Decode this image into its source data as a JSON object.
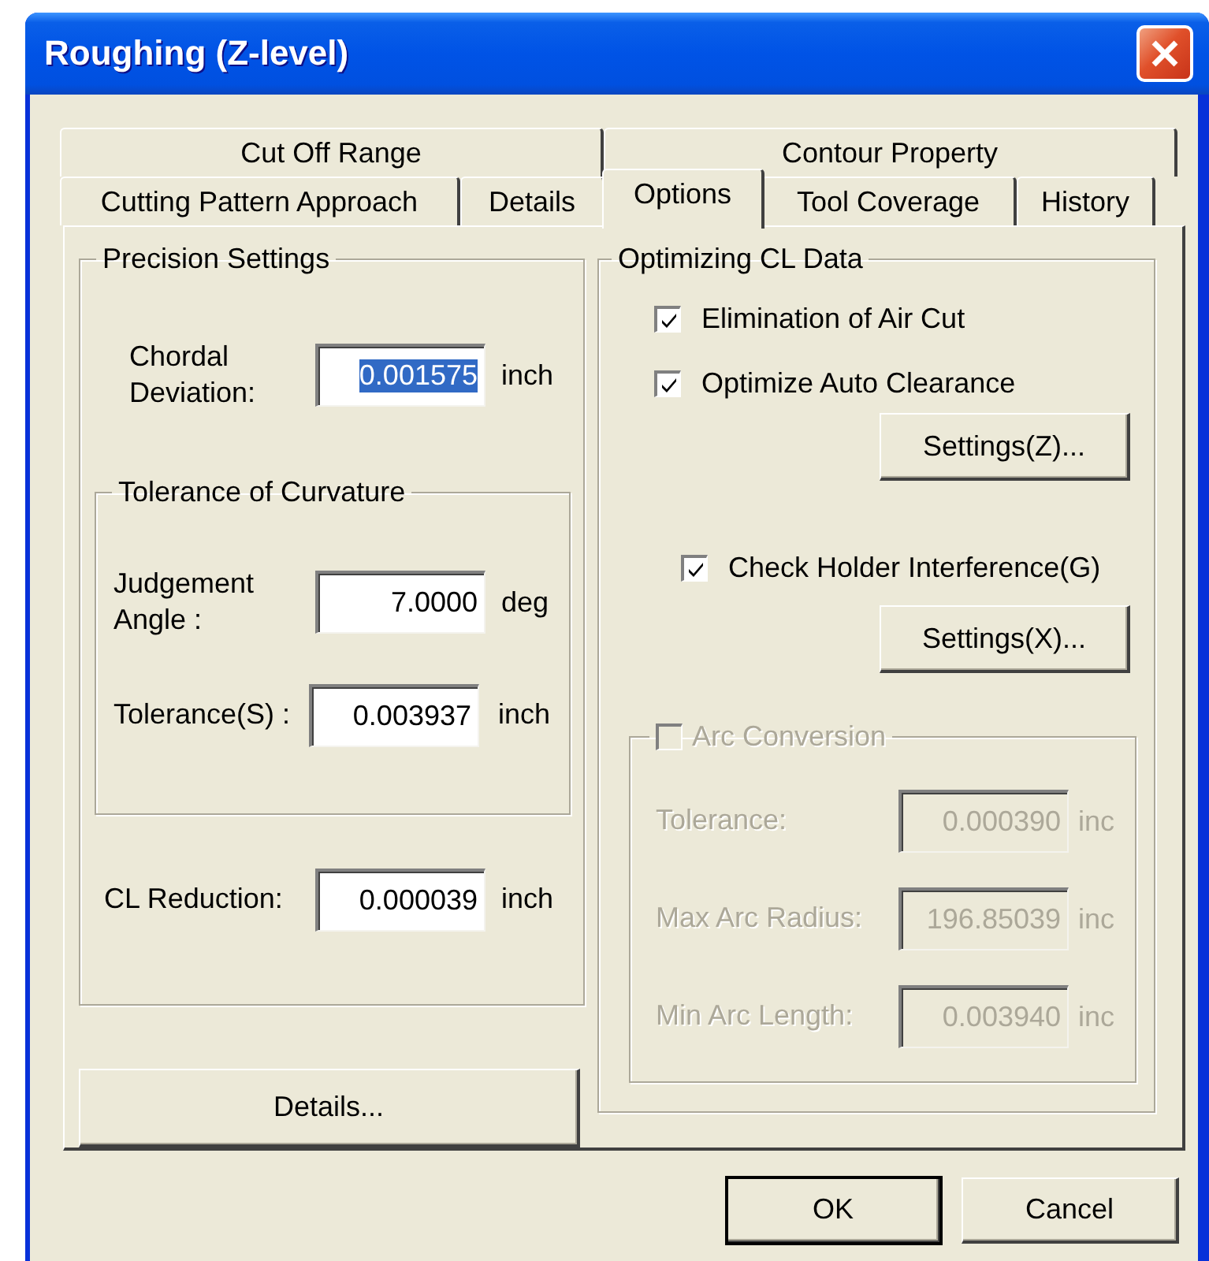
{
  "window": {
    "title": "Roughing (Z-level)"
  },
  "tab_rows": [
    [
      {
        "label": "Cut Off Range",
        "selected": false
      },
      {
        "label": "Contour Property",
        "selected": false
      }
    ],
    [
      {
        "label": "Cutting Pattern Approach",
        "selected": false
      },
      {
        "label": "Details",
        "selected": false
      },
      {
        "label": "Options",
        "selected": true
      },
      {
        "label": "Tool Coverage",
        "selected": false
      },
      {
        "label": "History",
        "selected": false
      }
    ]
  ],
  "precision_settings": {
    "title": "Precision Settings",
    "chordal_deviation": {
      "label": "Chordal Deviation:",
      "value": "0.001575",
      "unit": "inch",
      "highlighted": true
    },
    "tolerance_of_curvature": {
      "title": "Tolerance of Curvature",
      "fields": [
        {
          "label": "Judgement Angle :",
          "value": "7.0000",
          "unit": "deg",
          "highlighted": false
        },
        {
          "label": "Tolerance(S) :",
          "value": "0.003937",
          "unit": "inch",
          "highlighted": false
        }
      ]
    },
    "cl_reduction": {
      "label": "CL Reduction:",
      "value": "0.000039",
      "unit": "inch",
      "highlighted": false
    }
  },
  "details_button": {
    "label": "Details..."
  },
  "optimizing_cl_data": {
    "title": "Optimizing CL Data",
    "items": [
      {
        "kind": "checkbox",
        "label": "Elimination of Air Cut",
        "checked": true
      },
      {
        "kind": "checkbox",
        "label": "Optimize Auto Clearance",
        "checked": true
      },
      {
        "kind": "button",
        "label": "Settings(Z)..."
      },
      {
        "kind": "checkbox",
        "label": "Check Holder Interference(G)",
        "checked": true
      },
      {
        "kind": "button",
        "label": "Settings(X)..."
      }
    ],
    "arc_conversion": {
      "label": "Arc Conversion",
      "checked": false,
      "disabled": true,
      "fields": [
        {
          "label": "Tolerance:",
          "value": "0.000390",
          "unit": "inc"
        },
        {
          "label": "Max Arc Radius:",
          "value": "196.85039",
          "unit": "inc"
        },
        {
          "label": "Min Arc Length:",
          "value": "0.003940",
          "unit": "inc"
        }
      ]
    }
  },
  "buttons": [
    {
      "label": "OK",
      "default": true
    },
    {
      "label": "Cancel",
      "default": false
    }
  ]
}
